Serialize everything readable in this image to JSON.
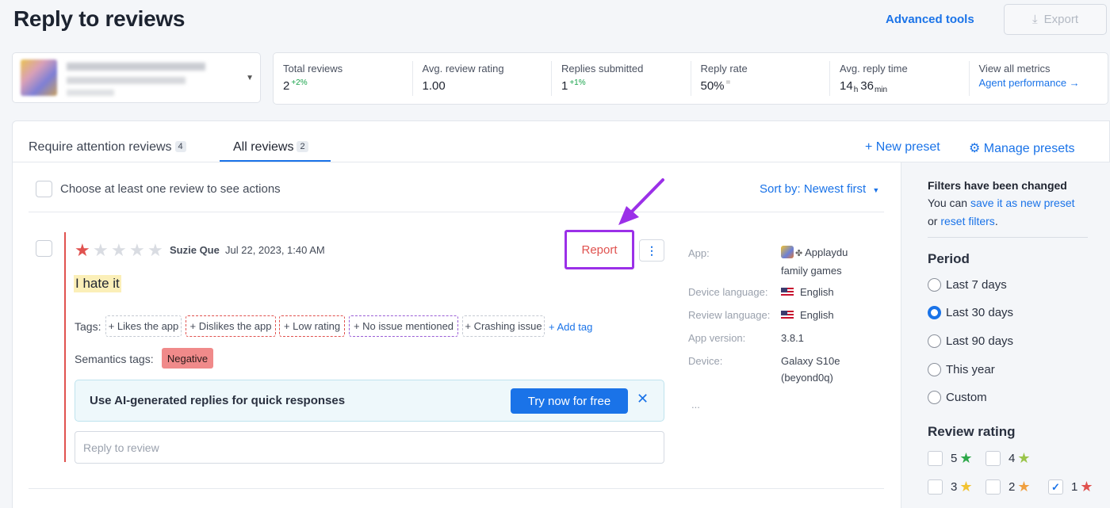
{
  "header": {
    "title": "Reply to reviews",
    "advanced_tools": "Advanced tools",
    "export_label": "Export"
  },
  "metrics": [
    {
      "label": "Total reviews",
      "value": "2",
      "delta": "+2%"
    },
    {
      "label": "Avg. review rating",
      "value": "1.00"
    },
    {
      "label": "Replies submitted",
      "value": "1",
      "delta": "+1%"
    },
    {
      "label": "Reply rate",
      "value": "50%",
      "delta": "="
    },
    {
      "label": "Avg. reply time",
      "hours": "14",
      "hours_unit": "h",
      "minutes": "36",
      "minutes_unit": "min"
    },
    {
      "label": "View all metrics",
      "link": "Agent performance →"
    }
  ],
  "tabs": [
    {
      "label": "Require attention reviews",
      "count": "4"
    },
    {
      "label": "All reviews",
      "count": "2"
    }
  ],
  "presets": {
    "new": "+ New preset",
    "manage": "Manage presets"
  },
  "list": {
    "choose_text": "Choose at least one review to see actions",
    "sort_by": "Sort by: Newest first"
  },
  "review": {
    "rating": 1,
    "reviewer": "Suzie Que",
    "date": "Jul 22, 2023, 1:40 AM",
    "report": "Report",
    "more": "⋮",
    "text": "I hate it",
    "tags_label": "Tags:",
    "tags": [
      "+ Likes the app",
      "+ Dislikes the app",
      "+ Low rating",
      "+ No issue mentioned",
      "+ Crashing issue"
    ],
    "add_tag": "+ Add tag",
    "semantics_label": "Semantics tags:",
    "semantics_badge": "Negative",
    "ai_banner_text": "Use AI-generated replies for quick responses",
    "ai_button": "Try now for free",
    "ai_close": "✕",
    "reply_placeholder": "Reply to review"
  },
  "meta": {
    "app_label": "App:",
    "app_value_1": "Applaydu",
    "app_value_2": "family games",
    "device_lang_label": "Device language:",
    "device_lang_value": "English",
    "review_lang_label": "Review language:",
    "review_lang_value": "English",
    "app_version_label": "App version:",
    "app_version_value": "3.8.1",
    "device_label": "Device:",
    "device_value_1": "Galaxy S10e",
    "device_value_2": "(beyond0q)",
    "more": "..."
  },
  "filters": {
    "title": "Filters have been changed",
    "msg_prefix": "You can ",
    "save_link": "save it as new preset",
    "msg_or": "or ",
    "reset_link": "reset filters",
    "msg_end": ".",
    "period_title": "Period",
    "periods": [
      "Last 7 days",
      "Last 30 days",
      "Last 90 days",
      "This year",
      "Custom"
    ],
    "selected_period": "Last 30 days",
    "rating_title": "Review rating",
    "ratings": [
      "5",
      "4",
      "3",
      "2",
      "1"
    ],
    "checked_rating": "1"
  },
  "colors": {
    "accent": "#1a73e8",
    "danger": "#e0524f",
    "highlight_purple": "#9b30e8",
    "star_5": "#2ea84a",
    "star_4": "#9ac44a",
    "star_3": "#f2c230",
    "star_2": "#f0a040",
    "star_1": "#e0524f"
  }
}
